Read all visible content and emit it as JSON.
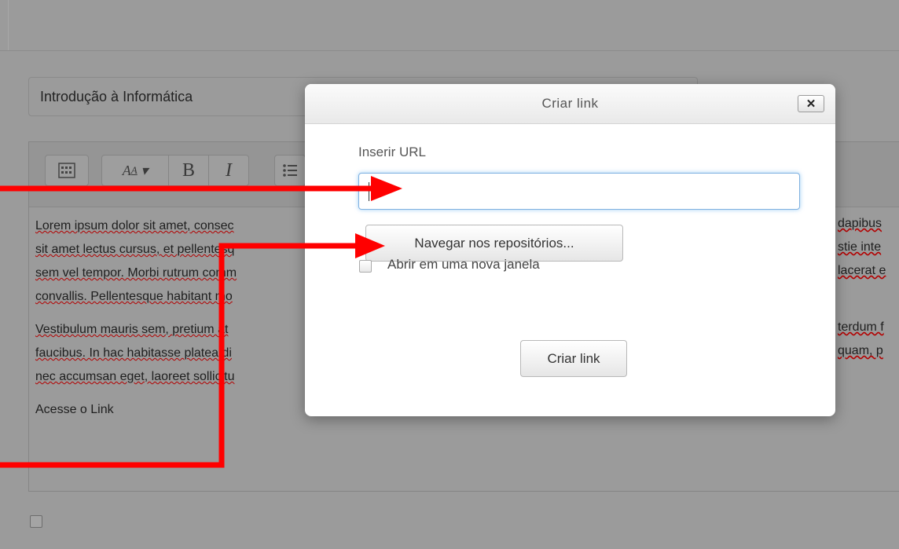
{
  "background": {
    "course_title": "Introdução à Informática",
    "paragraphs": [
      {
        "lines": [
          "Lorem ipsum dolor sit amet, consec",
          "sit amet lectus cursus, et pellentesq",
          "sem vel tempor. Morbi rutrum comm",
          "convallis. Pellentesque habitant mo"
        ]
      },
      {
        "lines": [
          "Vestibulum mauris sem, pretium at",
          "faucibus. In hac habitasse platea di",
          "nec accumsan eget, laoreet sollicitu"
        ]
      }
    ],
    "right_fragments": [
      "dapibus",
      "stie inte",
      "lacerat e",
      "terdum f",
      "quam, p"
    ],
    "link_text": "Acesse o Link"
  },
  "dialog": {
    "title": "Criar link",
    "close_label": "✕",
    "url_label": "Inserir URL",
    "url_value": "",
    "browse_label": "Navegar nos repositórios...",
    "new_window_label": "Abrir em uma nova janela",
    "new_window_checked": false,
    "submit_label": "Criar link"
  },
  "annotation": {
    "arrow_color": "#ff0000"
  }
}
